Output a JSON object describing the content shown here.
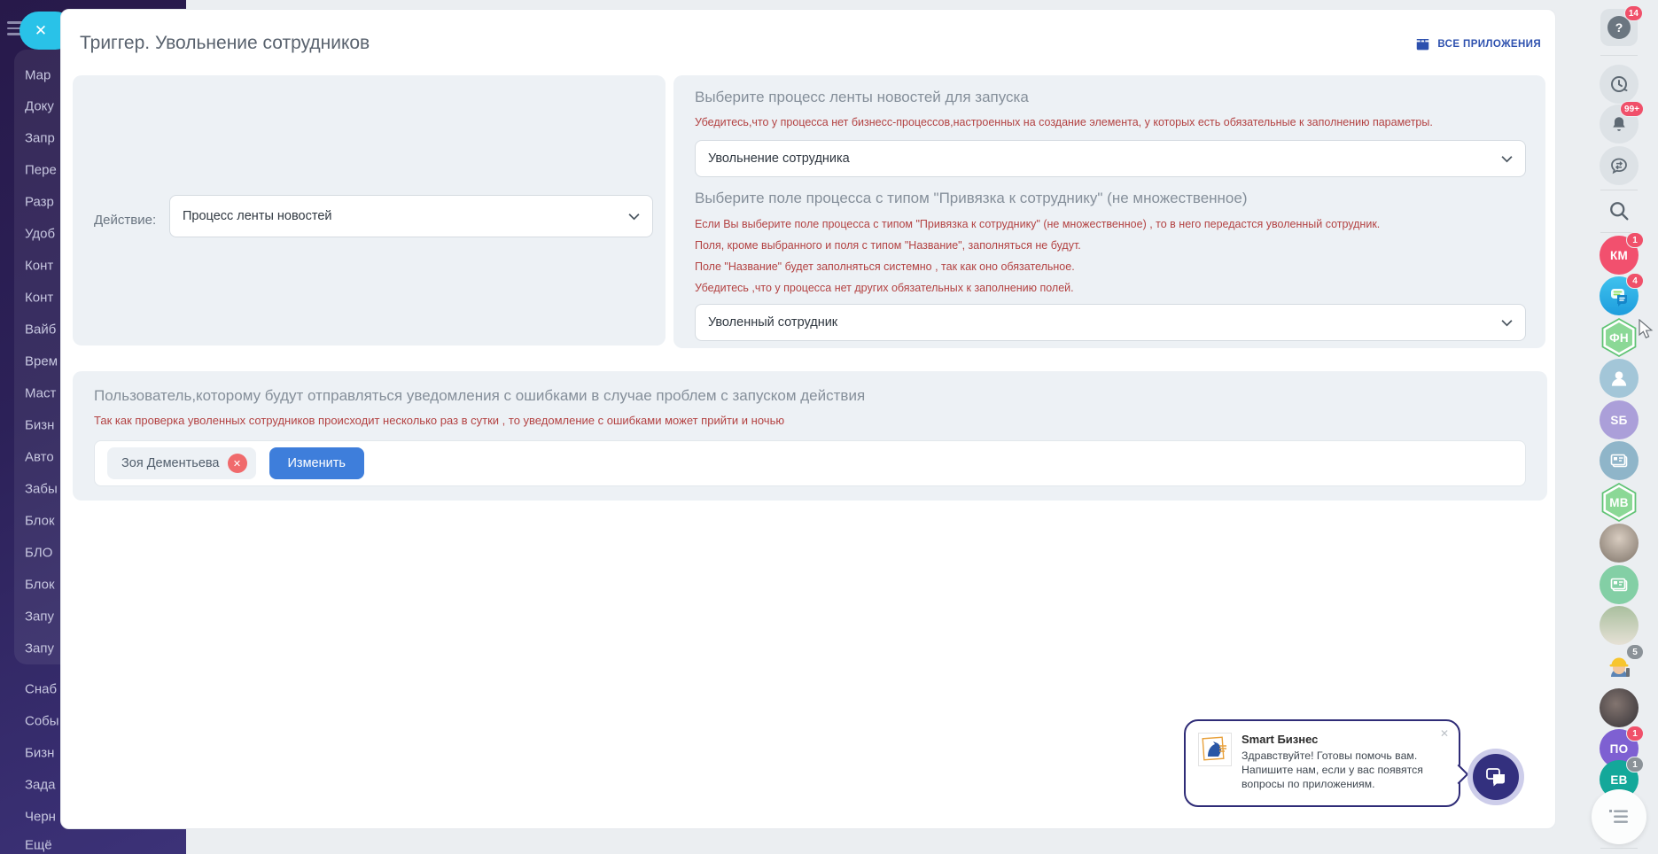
{
  "window": {
    "title": "Триггер. Увольнение сотрудников",
    "all_apps_label": "ВСЕ ПРИЛОЖЕНИЯ"
  },
  "sidebar": {
    "items": [
      "Мар",
      "Доку",
      "Запр",
      "Пере",
      "Разр",
      "Удоб",
      "Конт",
      "Конт",
      "Вайб",
      "Врем",
      "Маст",
      "Бизн",
      "Авто",
      "Забы",
      "Блок",
      "БЛО",
      "Блок",
      "Запу",
      "Запу",
      "Снаб",
      "Собы",
      "Бизн",
      "Зада",
      "Черн",
      "Ещё"
    ]
  },
  "action_section": {
    "label": "Действие:",
    "select_value": "Процесс ленты новостей"
  },
  "process_section": {
    "heading": "Выберите процесс ленты новостей для запуска",
    "warning": "Убедитесь,что у процесса нет бизнесс-процессов,настроенных на создание элемента, у которых есть обязательные к заполнению параметры.",
    "select_value": "Увольнение сотрудника",
    "field_heading": "Выберите поле процесса с типом \"Привязка к сотруднику\" (не множественное)",
    "field_warnings": [
      "Если Вы выберите поле процесса с типом \"Привязка к сотруднику\" (не множественное) , то в него передастся уволенный сотрудник.",
      "Поля, кроме выбранного и поля с типом \"Название\", заполняться не будут.",
      "Поле \"Название\" будет заполняться системно , так как оно обязательное.",
      "Убедитесь ,что у процесса нет других обязательных к заполнению полей."
    ],
    "field_select_value": "Уволенный сотрудник"
  },
  "notify_section": {
    "heading": "Пользователь,которому будут отправляться уведомления с ошибками в случае проблем с запуском действия",
    "warning": "Так как проверка уволенных сотрудников происходит несколько раз в сутки , то уведомление с ошибками может прийти и ночью",
    "user_chip": "Зоя Дементьева",
    "change_button": "Изменить"
  },
  "right_rail": {
    "help_badge": "14",
    "bell_badge": "99+",
    "avatars": [
      {
        "initials": "КМ",
        "badge": "1"
      },
      {
        "initials": "",
        "badge": "4"
      },
      {
        "initials": "ФН",
        "badge": ""
      },
      {
        "initials": "",
        "badge": ""
      },
      {
        "initials": "SБ",
        "badge": ""
      },
      {
        "initials": "",
        "badge": ""
      },
      {
        "initials": "МВ",
        "badge": ""
      },
      {
        "initials": "",
        "badge": ""
      },
      {
        "initials": "",
        "badge": ""
      },
      {
        "initials": "",
        "badge": ""
      },
      {
        "initials": "",
        "badge": "5"
      },
      {
        "initials": "",
        "badge": ""
      },
      {
        "initials": "ПО",
        "badge": "1"
      },
      {
        "initials": "ЕВ",
        "badge": "1"
      }
    ]
  },
  "chat_widget": {
    "title": "Smart Бизнес",
    "message": "Здравствуйте! Готовы помочь вам. Напишите нам, если у вас появятся вопросы по приложениям.",
    "close": "✕"
  },
  "icons": {
    "close_x": "✕",
    "help": "?",
    "exchange_arrows": "⇄"
  },
  "colors": {
    "sidebar_top": "#27194a",
    "sidebar_bottom": "#3c3278",
    "cyan_button": "#29c2e8",
    "accent_blue": "#3e7edb",
    "link_blue": "#2d50ae",
    "warning_red": "#b34242",
    "chip_badge_red": "#f06a6c",
    "rail_badge_red": "#f0506a",
    "rail_badge_gray": "#8b9298",
    "panel_gray": "#edf1f5",
    "avatar_pink": "#f2506e",
    "avatar_purple": "#7e60d2",
    "avatar_teal": "#14a89a",
    "avatar_lavender": "#ab9fd9",
    "hex_green": "#8bd896",
    "chat_border": "#2f2c77"
  }
}
